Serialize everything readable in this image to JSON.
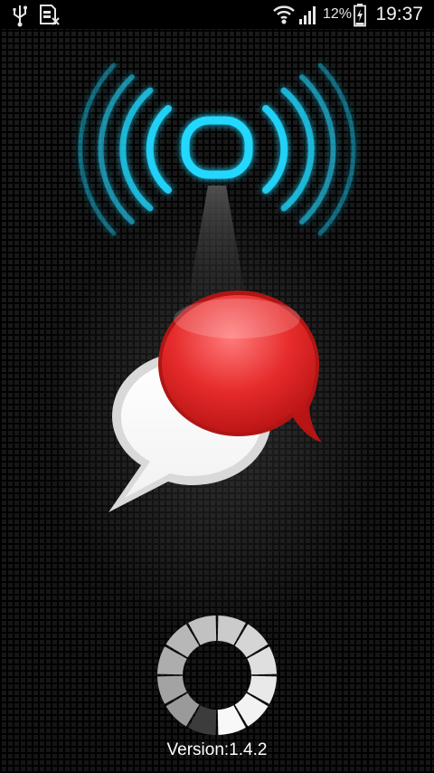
{
  "status_bar": {
    "icons": [
      "usb-icon",
      "sim-card-missing-icon",
      "wifi-icon",
      "signal-icon",
      "battery-icon"
    ],
    "battery_percent": "12%",
    "time": "19:37"
  },
  "splash": {
    "icons": [
      "wifi-antenna-icon",
      "chat-bubbles-icon",
      "loading-spinner-icon"
    ],
    "version": "Version:1.4.2",
    "colors": {
      "accent_cyan": "#22d8ff",
      "bubble_red": "#e8262a",
      "bubble_white": "#ffffff"
    }
  }
}
